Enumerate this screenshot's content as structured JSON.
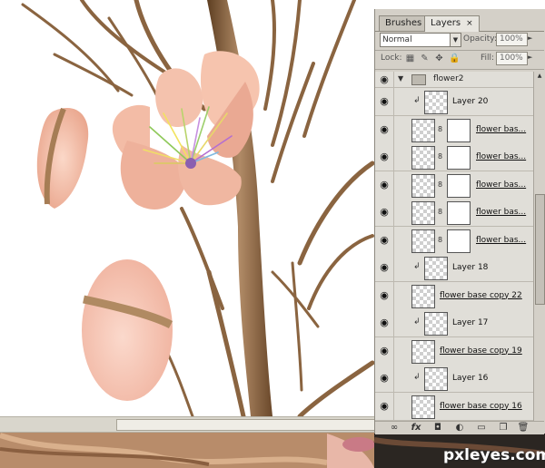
{
  "panel": {
    "tabs": [
      {
        "label": "Brushes",
        "active": false
      },
      {
        "label": "Layers",
        "active": true,
        "close": "×"
      }
    ],
    "blend_mode": "Normal",
    "opacity_label": "Opacity:",
    "opacity_value": "100%",
    "lock_label": "Lock:",
    "fill_label": "Fill:",
    "fill_value": "100%",
    "group_name": "flower2",
    "layers": [
      {
        "name": "Layer 20",
        "clipped": true,
        "mask": false,
        "underline": false
      },
      {
        "name": "flower bas...",
        "clipped": false,
        "mask": true,
        "underline": true
      },
      {
        "name": "flower bas...",
        "clipped": false,
        "mask": true,
        "underline": true
      },
      {
        "name": "flower bas...",
        "clipped": false,
        "mask": true,
        "underline": true
      },
      {
        "name": "flower bas...",
        "clipped": false,
        "mask": true,
        "underline": true
      },
      {
        "name": "flower bas...",
        "clipped": false,
        "mask": true,
        "underline": true
      },
      {
        "name": "Layer 18",
        "clipped": true,
        "mask": false,
        "underline": false
      },
      {
        "name": "flower base copy 22",
        "clipped": false,
        "mask": false,
        "underline": true
      },
      {
        "name": "Layer 17",
        "clipped": true,
        "mask": false,
        "underline": false
      },
      {
        "name": "flower base copy 19",
        "clipped": false,
        "mask": false,
        "underline": true
      },
      {
        "name": "Layer 16",
        "clipped": true,
        "mask": false,
        "underline": false
      },
      {
        "name": "flower base copy 16",
        "clipped": false,
        "mask": false,
        "underline": true
      }
    ],
    "bottom_icons": [
      "link-icon",
      "fx-icon",
      "mask-icon",
      "adjustment-icon",
      "group-icon",
      "new-layer-icon",
      "trash-icon"
    ],
    "bottom_glyphs": [
      "∞",
      "fx",
      "◘",
      "◐",
      "▭",
      "❐",
      "🗑"
    ]
  },
  "watermark": "pxleyes.com",
  "colors": {
    "panel_bg": "#d4d0c8",
    "stem": "#8a6440",
    "petal": "#f2b9a3"
  }
}
